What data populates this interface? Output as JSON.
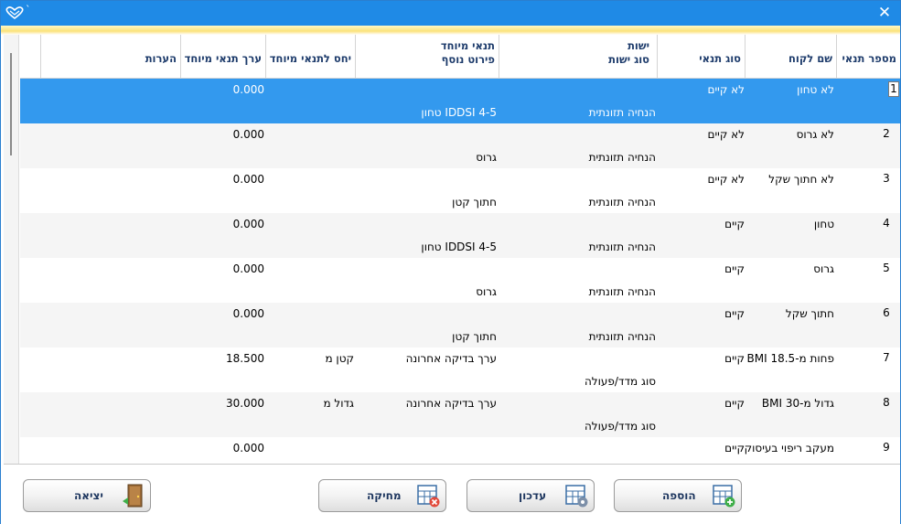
{
  "window": {
    "title": "ˋ",
    "close_glyph": "✕",
    "logo_icon": "heart-logo-icon",
    "accent_color": "#1f8ae6"
  },
  "table": {
    "columns": [
      {
        "key": "id",
        "line1": "מספר תנאי",
        "line2": ""
      },
      {
        "key": "customer",
        "line1": "שם לקוח",
        "line2": ""
      },
      {
        "key": "cond_type",
        "line1": "סוג תנאי",
        "line2": ""
      },
      {
        "key": "entity",
        "line1": "ישות",
        "line2": "סוג ישות"
      },
      {
        "key": "special",
        "line1": "תנאי מיוחד",
        "line2": "פירוט נוסף"
      },
      {
        "key": "relation",
        "line1": "יחס לתנאי מיוחד",
        "line2": ""
      },
      {
        "key": "value",
        "line1": "ערך תנאי מיוחד",
        "line2": ""
      },
      {
        "key": "notes",
        "line1": "הערות",
        "line2": ""
      }
    ],
    "selected_row": 0,
    "rows": [
      {
        "id": "1",
        "customer": "לא טחון",
        "cond_type": "לא קיים",
        "entity_type": "הנחיה תזונתית",
        "special": "",
        "detail": "IDDSI 4-5 טחון",
        "relation": "",
        "value": "0.000",
        "notes": ""
      },
      {
        "id": "2",
        "customer": "לא גרוס",
        "cond_type": "לא קיים",
        "entity_type": "הנחיה תזונתית",
        "special": "",
        "detail": "גרוס",
        "relation": "",
        "value": "0.000",
        "notes": ""
      },
      {
        "id": "3",
        "customer": "לא חתוך שקל",
        "cond_type": "לא קיים",
        "entity_type": "הנחיה תזונתית",
        "special": "",
        "detail": "חתוך קטן",
        "relation": "",
        "value": "0.000",
        "notes": ""
      },
      {
        "id": "4",
        "customer": "טחון",
        "cond_type": "קיים",
        "entity_type": "הנחיה תזונתית",
        "special": "",
        "detail": "IDDSI 4-5 טחון",
        "relation": "",
        "value": "0.000",
        "notes": ""
      },
      {
        "id": "5",
        "customer": "גרוס",
        "cond_type": "קיים",
        "entity_type": "הנחיה תזונתית",
        "special": "",
        "detail": "גרוס",
        "relation": "",
        "value": "0.000",
        "notes": ""
      },
      {
        "id": "6",
        "customer": "חתוך שקל",
        "cond_type": "קיים",
        "entity_type": "הנחיה תזונתית",
        "special": "",
        "detail": "חתוך קטן",
        "relation": "",
        "value": "0.000",
        "notes": ""
      },
      {
        "id": "7",
        "customer": "פחות מ-BMI 18.5",
        "cond_type": "קיים",
        "entity_type": "סוג מדד/פעולה",
        "special": "ערך בדיקה אחרונה",
        "detail": "",
        "relation": "קטן מ",
        "value": "18.500",
        "notes": ""
      },
      {
        "id": "8",
        "customer": "גדול מ-BMI 30",
        "cond_type": "קיים",
        "entity_type": "סוג מדד/פעולה",
        "special": "ערך בדיקה אחרונה",
        "detail": "",
        "relation": "גדול מ",
        "value": "30.000",
        "notes": ""
      },
      {
        "id": "9",
        "customer": "מעקב ריפוי בעיסוק",
        "cond_type": "קיים",
        "entity_type": "",
        "special": "",
        "detail": "",
        "relation": "",
        "value": "0.000",
        "notes": ""
      }
    ]
  },
  "buttons": {
    "add": {
      "label": "הוספה",
      "icon": "add-record-icon"
    },
    "update": {
      "label": "עדכון",
      "icon": "edit-record-icon"
    },
    "delete": {
      "label": "מחיקה",
      "icon": "delete-record-icon"
    },
    "exit": {
      "label": "יציאה",
      "icon": "exit-door-icon"
    }
  }
}
